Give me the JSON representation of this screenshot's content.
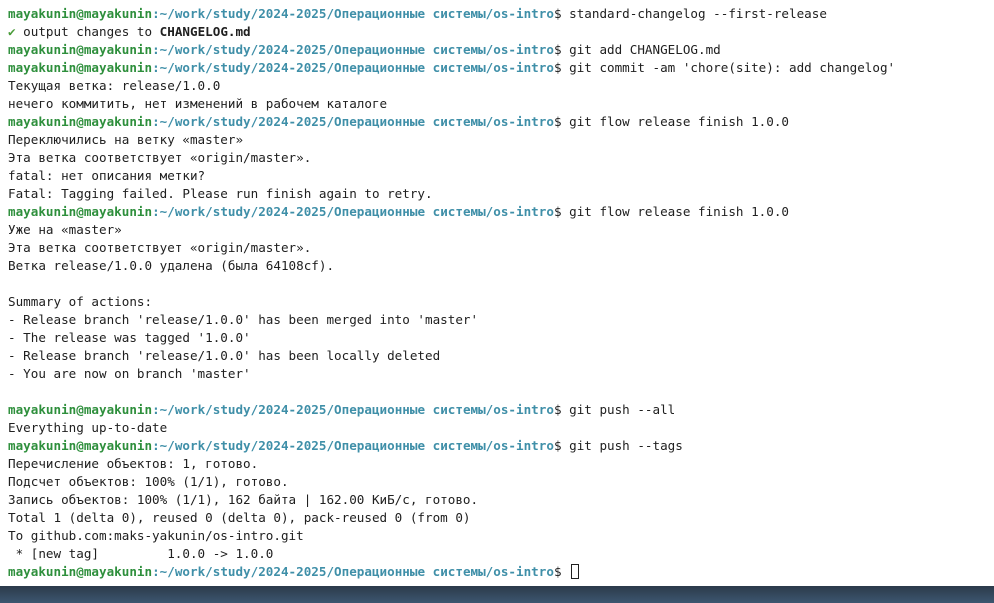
{
  "prompt": {
    "user": "mayakunin@mayakunin",
    "colon": ":",
    "path": "~/work/study/2024-2025/Операционные системы/os-intro",
    "dollar": "$ "
  },
  "colors": {
    "user": "#2e8f3c",
    "path": "#3f8fa8",
    "text": "#202020",
    "background": "#ffffff"
  },
  "lines": [
    {
      "type": "prompt",
      "cmd": "standard-changelog --first-release"
    },
    {
      "type": "check",
      "icon": "check-icon",
      "glyph": "✔",
      "text": " output changes to ",
      "bold": "CHANGELOG.md"
    },
    {
      "type": "prompt",
      "cmd": "git add CHANGELOG.md"
    },
    {
      "type": "prompt",
      "cmd": "git commit -am 'chore(site): add changelog'"
    },
    {
      "type": "text",
      "text": "Текущая ветка: release/1.0.0"
    },
    {
      "type": "text",
      "text": "нечего коммитить, нет изменений в рабочем каталоге"
    },
    {
      "type": "prompt",
      "cmd": "git flow release finish 1.0.0"
    },
    {
      "type": "text",
      "text": "Переключились на ветку «master»"
    },
    {
      "type": "text",
      "text": "Эта ветка соответствует «origin/master»."
    },
    {
      "type": "text",
      "text": "fatal: нет описания метки?"
    },
    {
      "type": "text",
      "text": "Fatal: Tagging failed. Please run finish again to retry."
    },
    {
      "type": "prompt",
      "cmd": "git flow release finish 1.0.0"
    },
    {
      "type": "text",
      "text": "Уже на «master»"
    },
    {
      "type": "text",
      "text": "Эта ветка соответствует «origin/master»."
    },
    {
      "type": "text",
      "text": "Ветка release/1.0.0 удалена (была 64108cf)."
    },
    {
      "type": "text",
      "text": ""
    },
    {
      "type": "text",
      "text": "Summary of actions:"
    },
    {
      "type": "text",
      "text": "- Release branch 'release/1.0.0' has been merged into 'master'"
    },
    {
      "type": "text",
      "text": "- The release was tagged '1.0.0'"
    },
    {
      "type": "text",
      "text": "- Release branch 'release/1.0.0' has been locally deleted"
    },
    {
      "type": "text",
      "text": "- You are now on branch 'master'"
    },
    {
      "type": "text",
      "text": ""
    },
    {
      "type": "prompt",
      "cmd": "git push --all"
    },
    {
      "type": "text",
      "text": "Everything up-to-date"
    },
    {
      "type": "prompt",
      "cmd": "git push --tags"
    },
    {
      "type": "text",
      "text": "Перечисление объектов: 1, готово."
    },
    {
      "type": "text",
      "text": "Подсчет объектов: 100% (1/1), готово."
    },
    {
      "type": "text",
      "text": "Запись объектов: 100% (1/1), 162 байта | 162.00 КиБ/с, готово."
    },
    {
      "type": "text",
      "text": "Total 1 (delta 0), reused 0 (delta 0), pack-reused 0 (from 0)"
    },
    {
      "type": "text",
      "text": "To github.com:maks-yakunin/os-intro.git"
    },
    {
      "type": "text",
      "text": " * [new tag]         1.0.0 -> 1.0.0"
    },
    {
      "type": "prompt",
      "cmd": "",
      "cursor": true
    }
  ]
}
